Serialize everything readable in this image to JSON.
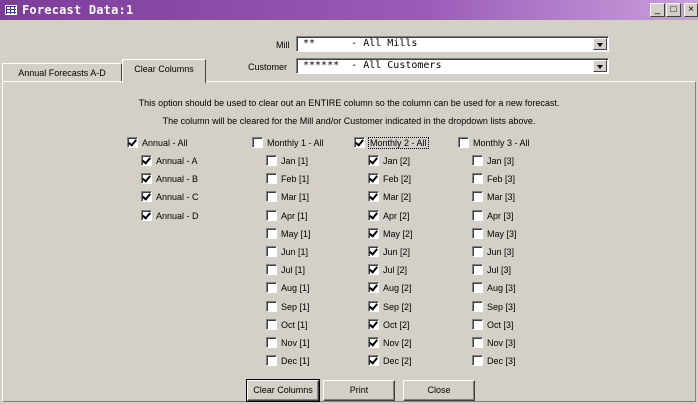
{
  "window": {
    "title": "Forecast Data:1",
    "minimize": "_",
    "maximize": "□",
    "close": "×"
  },
  "filters": {
    "mill_label": "Mill",
    "mill_value": "**      - All Mills",
    "customer_label": "Customer",
    "customer_value": "******  - All Customers"
  },
  "tabs": [
    {
      "label": "Annual Forecasts A-D",
      "active": false
    },
    {
      "label": "Clear Columns",
      "active": true
    }
  ],
  "instructions": [
    "This option should be used to clear out an ENTIRE column so the column can be used for a new forecast.",
    "The column will be cleared for the Mill and/or Customer indicated in the dropdown lists above."
  ],
  "columns": [
    {
      "header": {
        "label": "Annual - All",
        "checked": true
      },
      "items": [
        {
          "label": "Annual - A",
          "checked": true
        },
        {
          "label": "Annual - B",
          "checked": true
        },
        {
          "label": "Annual - C",
          "checked": true
        },
        {
          "label": "Annual - D",
          "checked": true
        }
      ]
    },
    {
      "header": {
        "label": "Monthly 1 - All",
        "checked": false
      },
      "items": [
        {
          "label": "Jan [1]",
          "checked": false
        },
        {
          "label": "Feb [1]",
          "checked": false
        },
        {
          "label": "Mar [1]",
          "checked": false
        },
        {
          "label": "Apr [1]",
          "checked": false
        },
        {
          "label": "May [1]",
          "checked": false
        },
        {
          "label": "Jun [1]",
          "checked": false
        },
        {
          "label": "Jul [1]",
          "checked": false
        },
        {
          "label": "Aug [1]",
          "checked": false
        },
        {
          "label": "Sep [1]",
          "checked": false
        },
        {
          "label": "Oct [1]",
          "checked": false
        },
        {
          "label": "Nov [1]",
          "checked": false
        },
        {
          "label": "Dec [1]",
          "checked": false
        }
      ]
    },
    {
      "header": {
        "label": "Monthly 2 - All",
        "checked": true,
        "focused": true
      },
      "items": [
        {
          "label": "Jan [2]",
          "checked": true
        },
        {
          "label": "Feb [2]",
          "checked": true
        },
        {
          "label": "Mar [2]",
          "checked": true
        },
        {
          "label": "Apr [2]",
          "checked": true
        },
        {
          "label": "May [2]",
          "checked": true
        },
        {
          "label": "Jun [2]",
          "checked": true
        },
        {
          "label": "Jul [2]",
          "checked": true
        },
        {
          "label": "Aug [2]",
          "checked": true
        },
        {
          "label": "Sep [2]",
          "checked": true
        },
        {
          "label": "Oct [2]",
          "checked": true
        },
        {
          "label": "Nov [2]",
          "checked": true
        },
        {
          "label": "Dec [2]",
          "checked": true
        }
      ]
    },
    {
      "header": {
        "label": "Monthly 3 - All",
        "checked": false
      },
      "items": [
        {
          "label": "Jan [3]",
          "checked": false
        },
        {
          "label": "Feb [3]",
          "checked": false
        },
        {
          "label": "Mar [3]",
          "checked": false
        },
        {
          "label": "Apr [3]",
          "checked": false
        },
        {
          "label": "May [3]",
          "checked": false
        },
        {
          "label": "Jun [3]",
          "checked": false
        },
        {
          "label": "Jul [3]",
          "checked": false
        },
        {
          "label": "Aug [3]",
          "checked": false
        },
        {
          "label": "Sep [3]",
          "checked": false
        },
        {
          "label": "Oct [3]",
          "checked": false
        },
        {
          "label": "Nov [3]",
          "checked": false
        },
        {
          "label": "Dec [3]",
          "checked": false
        }
      ]
    }
  ],
  "buttons": {
    "clear_columns": "Clear Columns",
    "print": "Print",
    "close": "Close"
  }
}
